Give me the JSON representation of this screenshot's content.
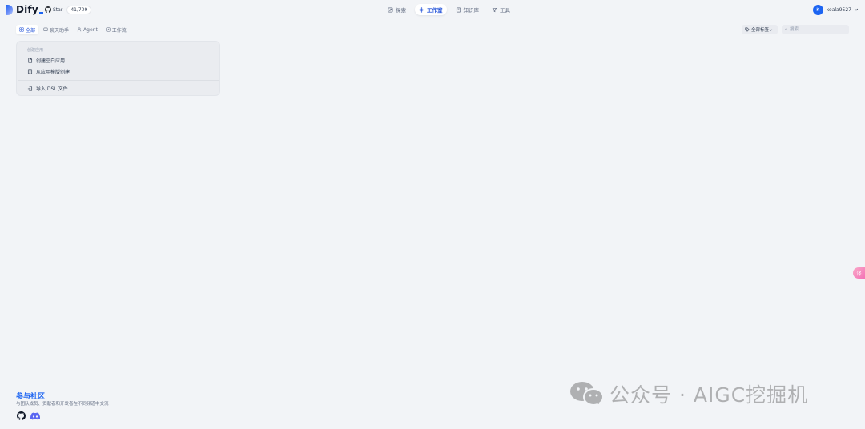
{
  "header": {
    "logo_text": "Dify",
    "github": {
      "label": "Star",
      "count": "41,709"
    },
    "nav": [
      {
        "label": "探索",
        "icon": "explore-icon",
        "active": false
      },
      {
        "label": "工作室",
        "icon": "studio-icon",
        "active": true
      },
      {
        "label": "知识库",
        "icon": "knowledge-icon",
        "active": false
      },
      {
        "label": "工具",
        "icon": "tools-icon",
        "active": false
      }
    ],
    "user": {
      "avatar_initial": "K",
      "name": "koala9527"
    }
  },
  "filters": {
    "tabs": [
      {
        "label": "全部",
        "icon": "grid-icon",
        "active": true
      },
      {
        "label": "聊天助手",
        "icon": "chat-icon",
        "active": false
      },
      {
        "label": "Agent",
        "icon": "agent-icon",
        "active": false
      },
      {
        "label": "工作流",
        "icon": "workflow-icon",
        "active": false
      }
    ],
    "tag_select": "全部标签",
    "search_placeholder": "搜索"
  },
  "create_card": {
    "title": "创建应用",
    "items": [
      {
        "label": "创建空白应用",
        "icon": "file-icon"
      },
      {
        "label": "从应用模版创建",
        "icon": "template-icon"
      },
      {
        "label": "导入 DSL 文件",
        "icon": "import-icon"
      }
    ]
  },
  "floating_button": {
    "label": "译"
  },
  "footer": {
    "title": "参与社区",
    "description": "与团队成员、贡献者和开发者在不同频道中交流"
  },
  "watermark": {
    "text": "公众号 · AIGC挖掘机"
  },
  "colors": {
    "accent": "#1c64f2",
    "background": "#f2f4f7",
    "card": "#eaecf0"
  }
}
